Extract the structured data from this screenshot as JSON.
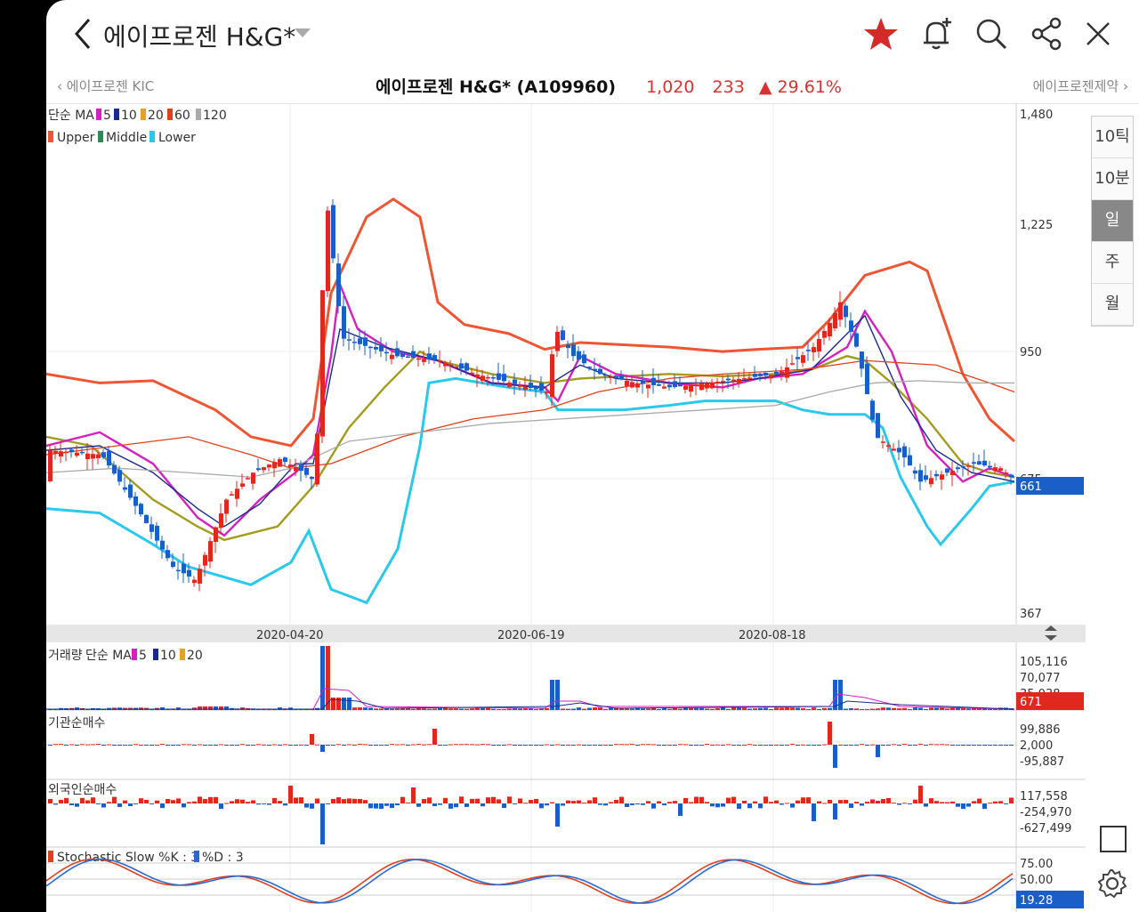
{
  "header": {
    "title": "에이프로젠 H&G*",
    "icons": [
      "back-icon",
      "dropdown-caret-icon",
      "favorite-star-icon",
      "add-alarm-bell-icon",
      "search-icon",
      "share-icon",
      "close-icon"
    ],
    "star_color": "#d42a2a"
  },
  "subheader": {
    "prev_stock": "에이프로젠 KIC",
    "next_stock": "에이프로젠제약",
    "name_code": "에이프로젠 H&G* (A109960)",
    "price": "1,020",
    "change": "233",
    "percent": "29.61%",
    "up_color": "#d93030"
  },
  "period_tabs": [
    "10틱",
    "10분",
    "일",
    "주",
    "월"
  ],
  "active_period": "일",
  "colors": {
    "up_candle": "#e0281e",
    "down_candle": "#1a5fc8",
    "ma5": "#d61fbf",
    "ma10": "#1a2a8c",
    "ma20": "#a39b1e",
    "ma60": "#e0401e",
    "ma120": "#aaaaaa",
    "bb_upper": "#ee5533",
    "bb_lower": "#2ac8ea",
    "stoch_k": "#e0401e",
    "stoch_d": "#2a6ad0"
  },
  "chart_data": [
    {
      "type": "candlestick",
      "title": "",
      "legend": {
        "ma_prefix": "단순 MA",
        "ma_periods": [
          "5",
          "10",
          "20",
          "60",
          "120"
        ],
        "bands": [
          "Upper",
          "Middle",
          "Lower"
        ]
      },
      "y_ticks": [
        "1,480",
        "1,225",
        "950",
        "675",
        "367"
      ],
      "ylim": [
        367,
        1480
      ],
      "x_ticks": [
        "2020-04-20",
        "2020-06-19",
        "2020-08-18"
      ],
      "current_price_tag": "661",
      "approx_close_path": [
        {
          "date": "2020-03",
          "close": 640
        },
        {
          "date": "2020-04-01",
          "close": 450
        },
        {
          "date": "2020-04-20",
          "close": 850
        },
        {
          "date": "2020-04-22",
          "close": 1300
        },
        {
          "date": "2020-05-10",
          "close": 920
        },
        {
          "date": "2020-06-19",
          "close": 850
        },
        {
          "date": "2020-08-18",
          "close": 920
        },
        {
          "date": "2020-08-28",
          "close": 1060
        },
        {
          "date": "2020-09-10",
          "close": 690
        },
        {
          "date": "2020-10",
          "close": 661
        }
      ]
    },
    {
      "type": "bar",
      "title": "거래량",
      "legend": {
        "ma_prefix": "단순 MA",
        "ma_periods": [
          "5",
          "10",
          "20"
        ]
      },
      "y_ticks": [
        "105,116",
        "70,077",
        "35,038"
      ],
      "current_tag": "671"
    },
    {
      "type": "bar",
      "title": "기관순매수",
      "y_ticks": [
        "99,886",
        "2,000",
        "-95,887"
      ]
    },
    {
      "type": "bar",
      "title": "외국인순매수",
      "y_ticks": [
        "117,558",
        "-254,970",
        "-627,499"
      ]
    },
    {
      "type": "line",
      "title": "Stochastic Slow %K : 3",
      "d_label": "%D : 3",
      "y_ticks": [
        "75.00",
        "50.00"
      ],
      "current_tag": "19.28"
    }
  ]
}
